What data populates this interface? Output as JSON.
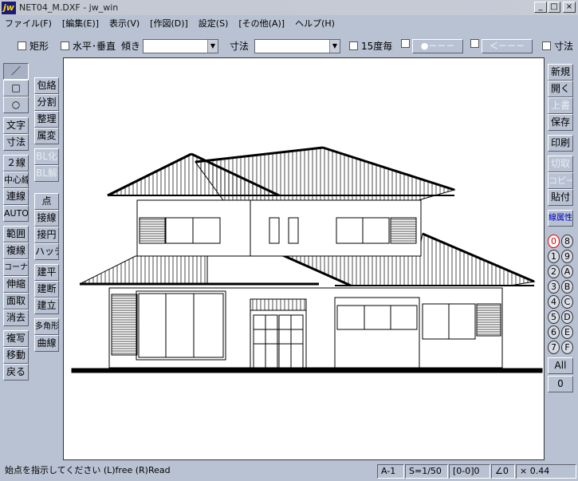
{
  "window": {
    "icon_text": "jw",
    "title": "NET04_M.DXF - jw_win",
    "min": "_",
    "max": "□",
    "close": "×"
  },
  "menu": [
    "ファイル(F)",
    "[編集(E)]",
    "表示(V)",
    "[作図(D)]",
    "設定(S)",
    "[その他(A)]",
    "ヘルプ(H)"
  ],
  "toolbar": {
    "rect": "矩形",
    "hv": "水平･垂直",
    "angle": "傾き",
    "angle_value": "",
    "dim": "寸法",
    "dim_value": "",
    "deg15": "15度毎",
    "btn1": "●－－－",
    "btn2": "＜－－－",
    "dim2": "寸法"
  },
  "left_col1": [
    {
      "label": "／",
      "sel": true
    },
    {
      "label": "□"
    },
    {
      "label": "○"
    },
    {
      "label": "文字"
    },
    {
      "label": "寸法"
    },
    {
      "label": "２線"
    },
    {
      "label": "中心線"
    },
    {
      "label": "連線"
    },
    {
      "label": "AUTO"
    },
    {
      "label": "範囲"
    },
    {
      "label": "複線"
    },
    {
      "label": "コーナー"
    },
    {
      "label": "伸縮"
    },
    {
      "label": "面取"
    },
    {
      "label": "消去"
    },
    {
      "label": "複写"
    },
    {
      "label": "移動"
    },
    {
      "label": "戻る"
    }
  ],
  "left_col2": [
    {
      "label": "包絡"
    },
    {
      "label": "分割"
    },
    {
      "label": "整理"
    },
    {
      "label": "属変"
    },
    {
      "label": "BL化",
      "dis": true
    },
    {
      "label": "BL解",
      "dis": true
    },
    {
      "label": "点"
    },
    {
      "label": "接線"
    },
    {
      "label": "接円"
    },
    {
      "label": "ハッチ"
    },
    {
      "label": "建平"
    },
    {
      "label": "建断"
    },
    {
      "label": "建立"
    },
    {
      "label": "多角形"
    },
    {
      "label": "曲線"
    }
  ],
  "right_col": [
    {
      "label": "新規"
    },
    {
      "label": "開く"
    },
    {
      "label": "上書",
      "dis": true
    },
    {
      "label": "保存"
    },
    {
      "label": "印刷"
    },
    {
      "label": "切取",
      "dis": true
    },
    {
      "label": "コピー",
      "dis": true
    },
    {
      "label": "貼付"
    },
    {
      "label": "線属性",
      "blue": true
    }
  ],
  "layers": [
    [
      "0",
      "8"
    ],
    [
      "1",
      "9"
    ],
    [
      "2",
      "A"
    ],
    [
      "3",
      "B"
    ],
    [
      "4",
      "C"
    ],
    [
      "5",
      "D"
    ],
    [
      "6",
      "E"
    ],
    [
      "7",
      "F"
    ]
  ],
  "layer_all": "All",
  "layer_group": "0",
  "status": {
    "message": "始点を指示してください (L)free (R)Read",
    "layer": "A-1",
    "scale": "S=1/50",
    "group": "[0-0]0",
    "angle": "∠0",
    "zoom": "× 0.44"
  }
}
